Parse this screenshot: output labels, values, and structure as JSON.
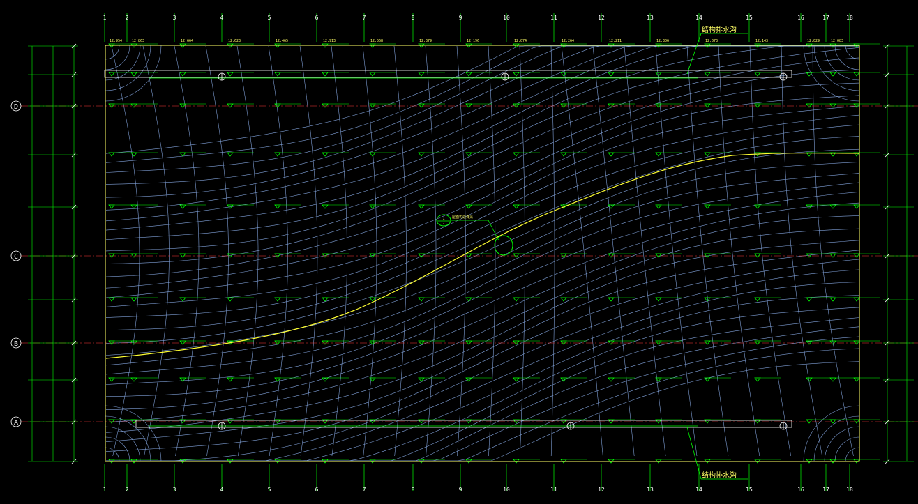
{
  "colors": {
    "background": "#000000",
    "axis_line": "#00ff00",
    "axis_dash": "#ff3b3b",
    "contour": "#7f9fd6",
    "drain_line": "#ffffff",
    "ridge": "#ffff33",
    "annotation": "#ffff66",
    "marker": "#00ff00",
    "leader": "#00ff00"
  },
  "column_axes": [
    "1",
    "2",
    "3",
    "4",
    "5",
    "6",
    "7",
    "8",
    "9",
    "10",
    "11",
    "12",
    "13",
    "14",
    "15",
    "16",
    "17",
    "18"
  ],
  "row_axes": [
    "D",
    "C",
    "B",
    "A"
  ],
  "annotations": {
    "drain_top": "结构排水沟",
    "drain_bottom": "结构排水沟",
    "detail_ref_top": "1",
    "detail_ref_bottom": "-",
    "detail_label": "屋面构造详见"
  },
  "elevation_tags": [
    "12.954",
    "12.863",
    "12.664",
    "12.623",
    "12.465",
    "12.913",
    "12.568",
    "12.379",
    "12.196",
    "12.074",
    "12.264",
    "12.211",
    "12.306",
    "12.073",
    "12.143",
    "12.029",
    "12.083"
  ],
  "icons": [
    "drain-icon",
    "elevation-marker-icon",
    "detail-callout-icon"
  ]
}
